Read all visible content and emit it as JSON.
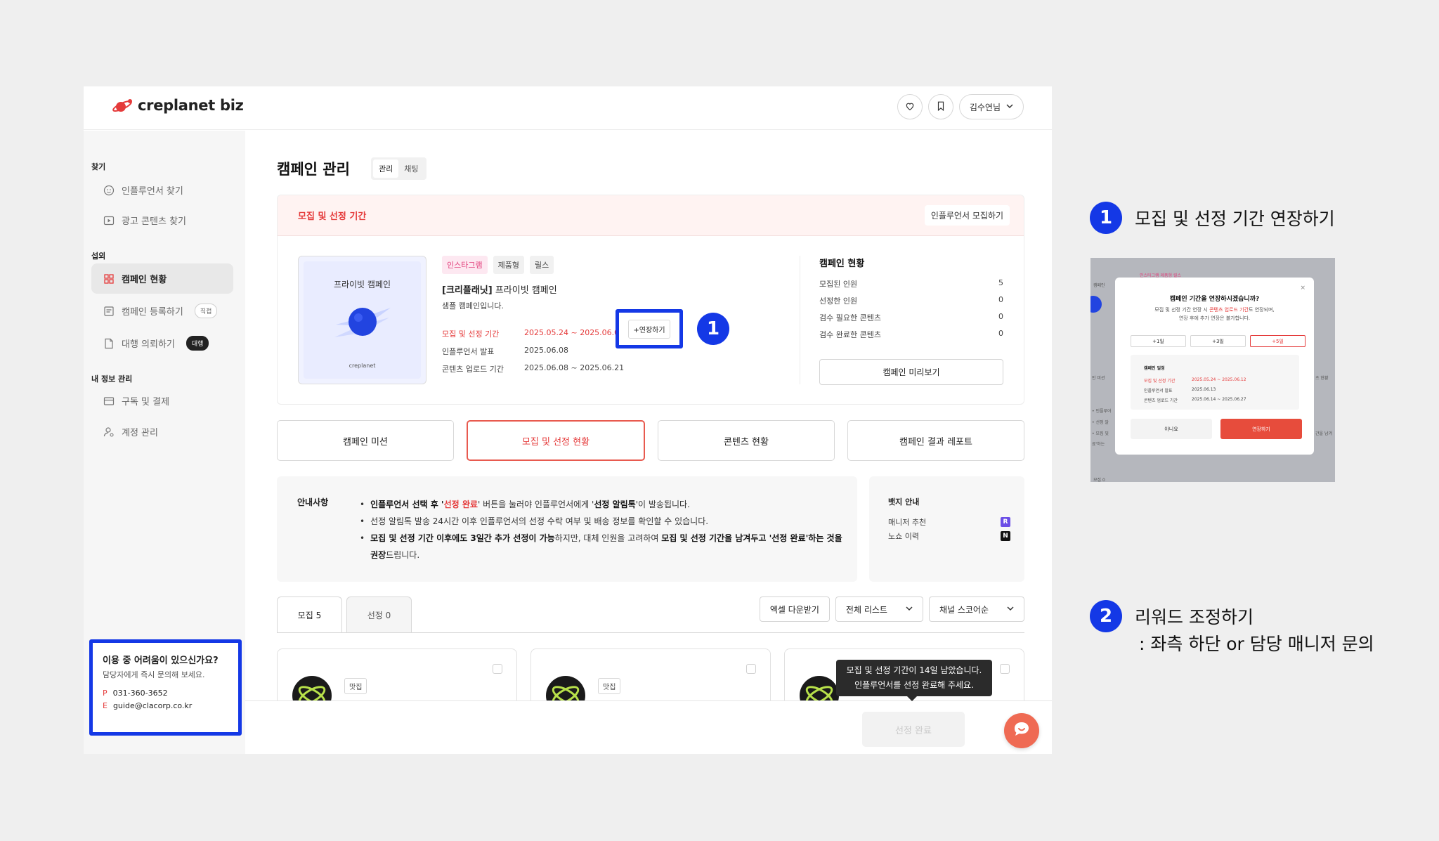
{
  "brand": {
    "name": "creplanet biz",
    "accent": "#e53a3a",
    "highlight": "#1438e6"
  },
  "header": {
    "user_label": "김수연님",
    "icons": [
      "heart-icon",
      "bookmark-icon",
      "chevron-down-icon"
    ]
  },
  "sidebar": {
    "sections": [
      {
        "title": "찾기",
        "items": [
          {
            "label": "인플루언서 찾기",
            "icon": "face-icon"
          },
          {
            "label": "광고 콘텐츠 찾기",
            "icon": "play-icon"
          }
        ]
      },
      {
        "title": "섭외",
        "items": [
          {
            "label": "캠페인 현황",
            "icon": "grid-icon",
            "active": true
          },
          {
            "label": "캠페인 등록하기",
            "icon": "form-icon",
            "badge": "직접"
          },
          {
            "label": "대행 의뢰하기",
            "icon": "document-icon",
            "badge": "대행"
          }
        ]
      },
      {
        "title": "내 정보 관리",
        "items": [
          {
            "label": "구독 및 결제",
            "icon": "card-icon"
          },
          {
            "label": "계정 관리",
            "icon": "user-gear-icon"
          }
        ]
      }
    ],
    "help": {
      "title": "이용 중 어려움이 있으신가요?",
      "subtitle": "담당자에게 즉시 문의해 보세요.",
      "phone_key": "P",
      "phone": "031-360-3652",
      "email_key": "E",
      "email": "guide@clacorp.co.kr"
    }
  },
  "main": {
    "title": "캠페인 관리",
    "segments": [
      "관리",
      "채팅"
    ],
    "period": {
      "header": "모집 및 선정 기간",
      "recruit_button": "인플루언서 모집하기",
      "thumb_title": "프라이빗 캠페인",
      "thumb_foot": "creplanet",
      "tags": [
        "인스타그램",
        "제품형",
        "릴스"
      ],
      "campaign_brand": "[크리플래닛]",
      "campaign_name": " 프라이빗 캠페인",
      "campaign_desc": "샘플 캠페인입니다.",
      "rows": [
        {
          "label": "모집 및 선정 기간",
          "value": "2025.05.24 ~ 2025.06.0"
        },
        {
          "label": "인플루언서 발표",
          "value": "2025.06.08"
        },
        {
          "label": "콘텐츠 업로드 기간",
          "value": "2025.06.08 ~ 2025.06.21"
        }
      ],
      "extend_button": "+연장하기",
      "status": {
        "title": "캠페인 현황",
        "rows": [
          {
            "label": "모집된 인원",
            "value": "5"
          },
          {
            "label": "선정한 인원",
            "value": "0"
          },
          {
            "label": "검수 필요한 콘텐츠",
            "value": "0"
          },
          {
            "label": "검수 완료한 콘텐츠",
            "value": "0"
          }
        ],
        "preview_button": "캠페인 미리보기"
      }
    },
    "tabs": [
      "캠페인 미션",
      "모집 및 선정 현황",
      "콘텐츠 현황",
      "캠페인 결과 레포트"
    ],
    "notice": {
      "title": "안내사항",
      "l1_a": "인플루언서 선택 후 '",
      "l1_b": "선정 완료",
      "l1_c": "' 버튼을 눌러야 인플루언서에게 '",
      "l1_d": "선정 알림톡",
      "l1_e": "'이 발송됩니다.",
      "l2": "선정 알림톡 발송 24시간 이후 인플루언서의 선정 수락 여부 및 배송 정보를 확인할 수 있습니다.",
      "l3_a": "모집 및 선정 기간 이후에도 3일간 추가 선정이 가능",
      "l3_b": "하지만, 대체 인원을 고려하여 ",
      "l3_c": "모집 및 선정 기간을 남겨두고 '선정 완료'하는 것을 권장",
      "l3_d": "드립니다."
    },
    "badge_info": {
      "title": "뱃지 안내",
      "rows": [
        {
          "label": "매니저 추천",
          "badge": "R",
          "color": "#6b4ee6"
        },
        {
          "label": "노쇼 이력",
          "badge": "N",
          "color": "#111111"
        }
      ]
    },
    "list_tabs": [
      "모집 5",
      "선정 0"
    ],
    "tools": [
      "엑셀 다운받기",
      "전체 리스트",
      "채널 스코어순"
    ],
    "cards": [
      {
        "category": "맛집"
      },
      {
        "category": "맛집"
      },
      {
        "category": ""
      }
    ],
    "tooltip_l1": "모집 및 선정 기간이 14일 남았습니다.",
    "tooltip_l2": "인플루언서를 선정 완료해 주세요.",
    "done_button": "선정 완료"
  },
  "annotations": {
    "n1": "1",
    "n1_text": "모집 및 선정 기간 연장하기",
    "n2": "2",
    "n2_text": "리워드 조정하기",
    "n2_sub": ": 좌측 하단 or 담당 매니저 문의"
  },
  "modal_preview": {
    "title": "캠페인 기간을 연장하시겠습니까?",
    "desc_a": "모집 및 선정 기간 연장 시 ",
    "desc_b": "콘텐츠 업로드 기간",
    "desc_c": "도 연장되며,",
    "desc_l2": "연장 후에 추가 연장은 불가합니다.",
    "options": [
      "+1일",
      "+3일",
      "+5일"
    ],
    "box_title": "캠페인 일정",
    "rows": [
      {
        "label": "모집 및 선정 기간",
        "value": "2025.05.24 ~ 2025.06.12"
      },
      {
        "label": "인플루언서 발표",
        "value": "2025.06.13"
      },
      {
        "label": "콘텐츠 업로드 기간",
        "value": "2025.06.14 ~ 2025.06.27"
      }
    ],
    "no": "아니요",
    "yes": "연장하기",
    "close": "×",
    "bg_frag_1": "인스타그램  제품형  릴스",
    "bg_frag_2": "캠페인",
    "bg_frag_3": "인 미션",
    "bg_frag_4": "츠 현황",
    "bg_frag_5": "• 인플루어",
    "bg_frag_6": "• 선정 알",
    "bg_frag_7": "• 모집 및",
    "bg_frag_8": "료'하는",
    "bg_frag_9": "간을 남겨",
    "bg_frag_10": "모집 0"
  }
}
